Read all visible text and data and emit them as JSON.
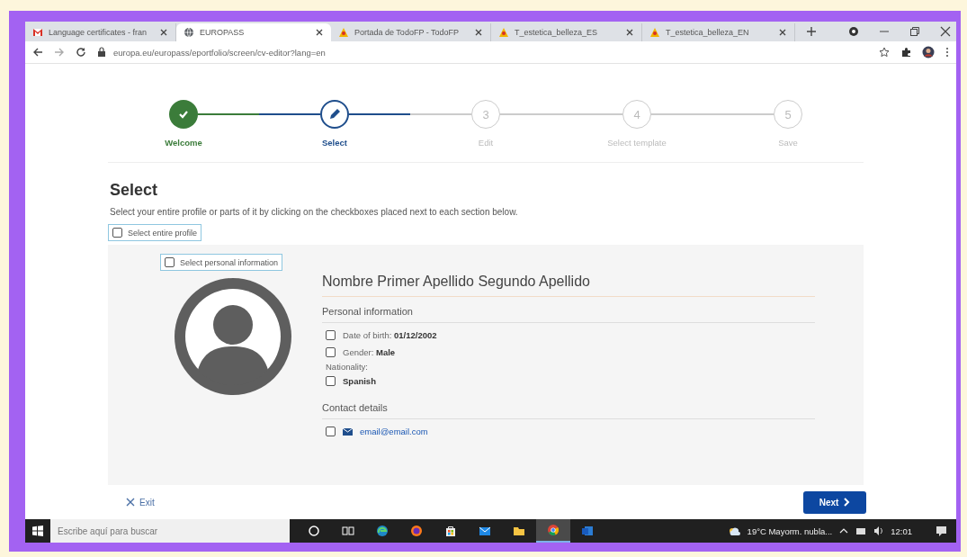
{
  "browser": {
    "tabs": [
      {
        "title": "Language certificates - fran",
        "kind": "mail",
        "selected": false
      },
      {
        "title": "EUROPASS",
        "kind": "globe",
        "selected": true
      },
      {
        "title": "Portada de TodoFP - TodoFP",
        "kind": "site",
        "selected": false
      },
      {
        "title": "T_estetica_belleza_ES",
        "kind": "site",
        "selected": false
      },
      {
        "title": "T_estetica_belleza_EN",
        "kind": "site",
        "selected": false
      }
    ],
    "url": "europa.eu/europass/eportfolio/screen/cv-editor?lang=en"
  },
  "steps": [
    {
      "label": "Welcome",
      "completed": true,
      "selected": false
    },
    {
      "label": "Select",
      "completed": false,
      "selected": true
    },
    {
      "label": "Edit",
      "completed": false,
      "selected": false,
      "number": "3"
    },
    {
      "label": "Select template",
      "completed": false,
      "selected": false,
      "number": "4"
    },
    {
      "label": "Save",
      "completed": false,
      "selected": false,
      "number": "5"
    }
  ],
  "page": {
    "title": "Select",
    "intro": "Select your entire profile or parts of it by clicking on the checkboxes placed next to each section below.",
    "select_all": {
      "label": "Select entire profile",
      "checked": false
    },
    "profile": {
      "select": {
        "label": "Select personal information",
        "checked": false
      },
      "name": "Nombre Primer Apellido Segundo Apellido",
      "sections": [
        {
          "title": "Personal information",
          "items": [
            {
              "kind": "field",
              "label": "Date of birth:",
              "value": "01/12/2002",
              "checked": false
            },
            {
              "kind": "field",
              "label": "Gender:",
              "value": "Male",
              "checked": false
            },
            {
              "kind": "caption",
              "label": "Nationality:"
            },
            {
              "kind": "field",
              "value": "Spanish",
              "checked": false
            }
          ]
        },
        {
          "title": "Contact details",
          "items": [
            {
              "kind": "email",
              "value": "email@email.com",
              "checked": false
            }
          ]
        }
      ]
    }
  },
  "footer": {
    "exit": "Exit",
    "next": "Next"
  },
  "taskbar": {
    "search_placeholder": "Escribe aquí para buscar",
    "apps": [
      {
        "kind": "cortana",
        "selected": false
      },
      {
        "kind": "taskview",
        "selected": false
      },
      {
        "kind": "edge",
        "selected": false
      },
      {
        "kind": "firefox",
        "selected": false
      },
      {
        "kind": "store",
        "selected": false
      },
      {
        "kind": "mail",
        "selected": false
      },
      {
        "kind": "files",
        "selected": false
      },
      {
        "kind": "chrome",
        "selected": true
      },
      {
        "kind": "word",
        "selected": false
      }
    ],
    "weather": "19°C  Mayorm. nubla...",
    "time": "12:01"
  }
}
